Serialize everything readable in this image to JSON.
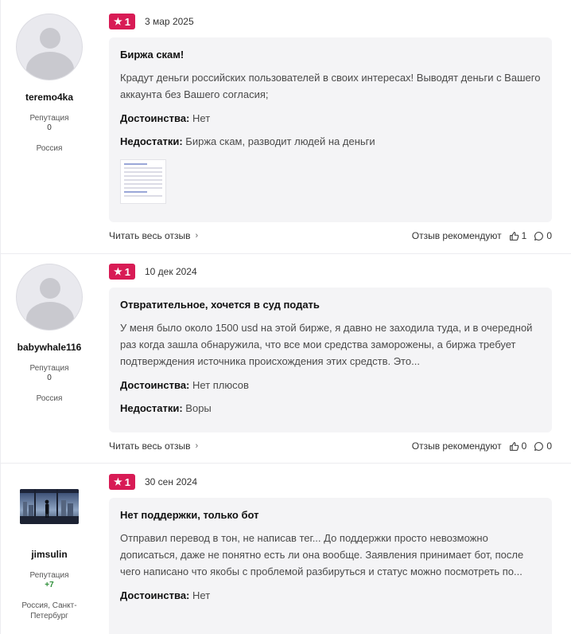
{
  "reviews": [
    {
      "author": "teremo4ka",
      "reputation_label": "Репутация",
      "reputation": "0",
      "location": "Россия",
      "rating": "1",
      "date": "3 мар 2025",
      "title": "Биржа скам!",
      "text": "Крадут деньги российских пользователей в своих интересах! Выводят деньги с Вашего аккаунта без Вашего согласия;",
      "pros_label": "Достоинства:",
      "pros": "Нет",
      "cons_label": "Недостатки:",
      "cons": "Биржа скам, разводит людей на деньги",
      "read_more": "Читать весь отзыв",
      "recommend_label": "Отзыв рекомендуют",
      "likes": "1",
      "comments": "0"
    },
    {
      "author": "babywhale116",
      "reputation_label": "Репутация",
      "reputation": "0",
      "location": "Россия",
      "rating": "1",
      "date": "10 дек 2024",
      "title": "Отвратительное, хочется в суд подать",
      "text": "У меня было около 1500 usd на этой бирже, я давно не заходила туда, и в очередной раз когда зашла обнаружила, что все мои средства заморожены, а биржа требует подтверждения источника происхождения этих средств. Это...",
      "pros_label": "Достоинства:",
      "pros": "Нет плюсов",
      "cons_label": "Недостатки:",
      "cons": "Воры",
      "read_more": "Читать весь отзыв",
      "recommend_label": "Отзыв рекомендуют",
      "likes": "0",
      "comments": "0"
    },
    {
      "author": "jimsulin",
      "reputation_label": "Репутация",
      "reputation": "+7",
      "location": "Россия, Санкт-Петербург",
      "rating": "1",
      "date": "30 сен 2024",
      "title": "Нет поддержки, только бот",
      "text": "Отправил перевод в тон, не написав тег... До поддержки просто невозможно дописаться, даже не понятно есть ли она вообще. Заявления принимает бот, после чего написано что якобы с проблемой разбируться и статус можно посмотреть по...",
      "pros_label": "Достоинства:",
      "pros": "Нет"
    }
  ],
  "colors": {
    "rating_badge": "#d81b55",
    "card_background": "#f4f4f6",
    "reputation_positive": "#2f8f3a"
  },
  "icons": {
    "rating": "star-icon",
    "chevron": "chevron-right-icon",
    "like": "thumbs-up-icon",
    "comment": "comment-bubble-icon"
  }
}
